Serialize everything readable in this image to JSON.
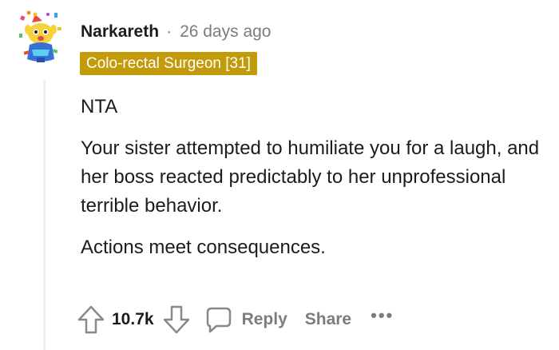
{
  "comment": {
    "username": "Narkareth",
    "separator": "·",
    "timestamp": "26 days ago",
    "flair": "Colo-rectal Surgeon [31]",
    "flair_color": "#c39a0a",
    "avatar_icon": "snoo-avatar-icon",
    "paragraphs": [
      "NTA",
      "Your sister attempted to humiliate you for a laugh, and her boss reacted predictably to her unprofessional terrible behavior.",
      "Actions meet consequences."
    ]
  },
  "actions": {
    "upvote_icon": "upvote-arrow-icon",
    "score": "10.7k",
    "downvote_icon": "downvote-arrow-icon",
    "reply_icon": "speech-bubble-icon",
    "reply_label": "Reply",
    "share_label": "Share",
    "more_label": "•••"
  }
}
